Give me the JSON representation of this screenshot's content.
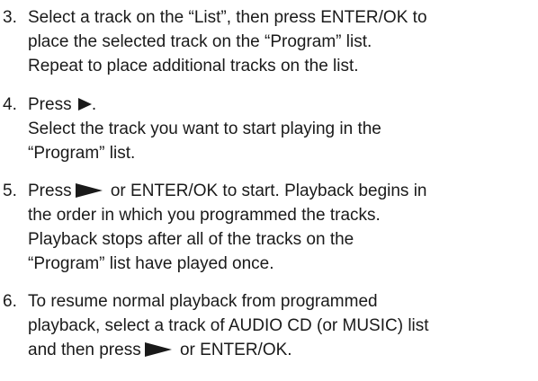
{
  "steps": [
    {
      "number": "3.",
      "lines": [
        "Select a track on the “List”, then press ENTER/OK to",
        "place the selected track on the “Program” list.",
        "Repeat to place additional tracks on the list."
      ]
    },
    {
      "number": "4.",
      "line1_before": "Press",
      "line1_after": ".",
      "lines": [
        "Select the track you want to start playing in the",
        "“Program” list."
      ]
    },
    {
      "number": "5.",
      "line1_before": "Press",
      "line1_after": " or ENTER/OK to start. Playback begins in",
      "lines": [
        "the order in which you programmed the tracks.",
        "Playback stops after all of the tracks on the",
        "“Program” list have played once."
      ]
    },
    {
      "number": "6.",
      "lines": [
        "To resume normal playback from programmed",
        "playback, select a track of AUDIO CD (or MUSIC) list"
      ],
      "last_before": "and then press",
      "last_after": " or ENTER/OK."
    }
  ],
  "icons": {
    "play": "play-icon"
  }
}
